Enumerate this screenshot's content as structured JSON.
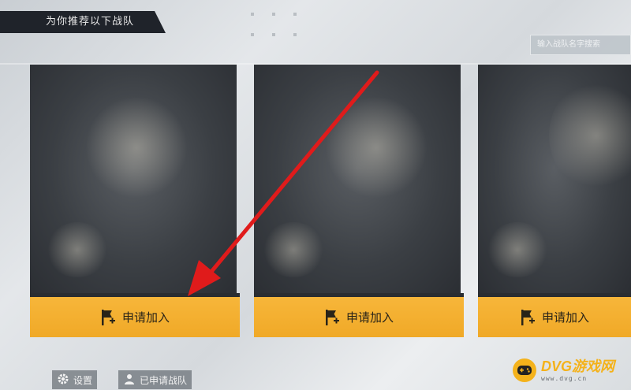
{
  "header": {
    "title": "为你推荐以下战队"
  },
  "search": {
    "placeholder": "输入战队名字搜索"
  },
  "teams": [
    {
      "join_label": "申请加入"
    },
    {
      "join_label": "申请加入"
    },
    {
      "join_label": "申请加入"
    }
  ],
  "footer": {
    "settings_label": "设置",
    "applied_label": "已申请战队"
  },
  "watermark": {
    "main": "DVG游戏网",
    "sub": "www.dvg.cn"
  },
  "colors": {
    "accent": "#f0a927",
    "annotation_arrow": "#e01b1b",
    "header_bg": "#1f232a"
  },
  "icons": {
    "join": "flag-plus-icon",
    "settings": "gear-icon",
    "applied": "team-people-icon",
    "watermark": "gamepad-icon"
  }
}
